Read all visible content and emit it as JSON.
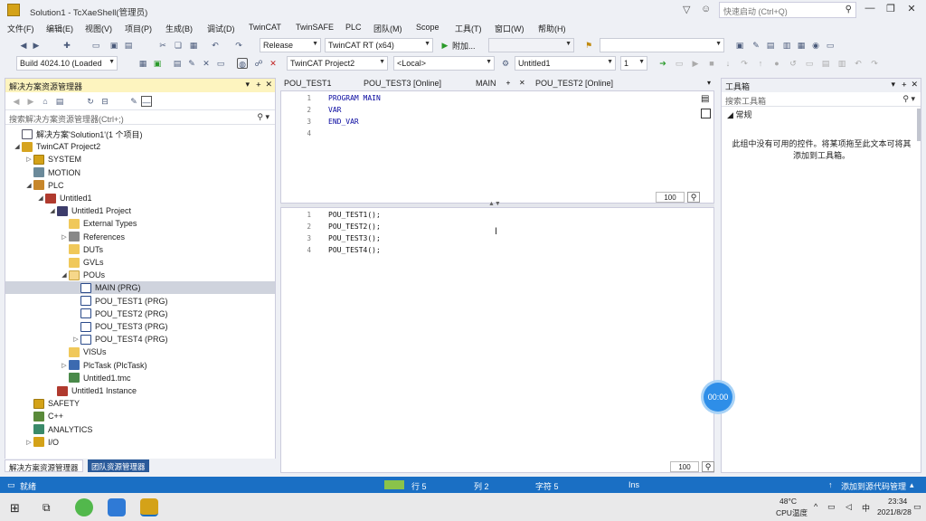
{
  "window": {
    "title": "Solution1 - TcXaeShell(管理员)",
    "quick_launch_placeholder": "快速启动 (Ctrl+Q)"
  },
  "menu": [
    "文件(F)",
    "编辑(E)",
    "视图(V)",
    "项目(P)",
    "生成(B)",
    "调试(D)",
    "TwinCAT",
    "TwinSAFE",
    "PLC",
    "团队(M)",
    "Scope",
    "工具(T)",
    "窗口(W)",
    "帮助(H)"
  ],
  "toolbar1": {
    "config": "Release",
    "platform": "TwinCAT RT (x64)",
    "attach": "附加..."
  },
  "toolbar2": {
    "build": "Build 4024.10 (Loaded",
    "project": "TwinCAT Project2",
    "target": "<Local>",
    "plc": "Untitled1",
    "instance": "1"
  },
  "solution_explorer": {
    "title": "解决方案资源管理器",
    "search_placeholder": "搜索解决方案资源管理器(Ctrl+;)",
    "tree": [
      {
        "label": "解决方案'Solution1'(1 个项目)",
        "level": 0,
        "exp": "",
        "icon": "sol"
      },
      {
        "label": "TwinCAT Project2",
        "level": 0,
        "exp": "◢",
        "icon": "tc"
      },
      {
        "label": "SYSTEM",
        "level": 1,
        "exp": "▷",
        "icon": "sys"
      },
      {
        "label": "MOTION",
        "level": 1,
        "exp": "",
        "icon": "mot"
      },
      {
        "label": "PLC",
        "level": 1,
        "exp": "◢",
        "icon": "plc"
      },
      {
        "label": "Untitled1",
        "level": 2,
        "exp": "◢",
        "icon": "prj2"
      },
      {
        "label": "Untitled1 Project",
        "level": 3,
        "exp": "◢",
        "icon": "proj"
      },
      {
        "label": "External Types",
        "level": 4,
        "exp": "",
        "icon": "fold"
      },
      {
        "label": "References",
        "level": 4,
        "exp": "▷",
        "icon": "ref"
      },
      {
        "label": "DUTs",
        "level": 4,
        "exp": "",
        "icon": "fold"
      },
      {
        "label": "GVLs",
        "level": 4,
        "exp": "",
        "icon": "fold"
      },
      {
        "label": "POUs",
        "level": 4,
        "exp": "◢",
        "icon": "foldo"
      },
      {
        "label": "MAIN (PRG)",
        "level": 5,
        "exp": "",
        "icon": "pou",
        "selected": true
      },
      {
        "label": "POU_TEST1 (PRG)",
        "level": 5,
        "exp": "",
        "icon": "pou"
      },
      {
        "label": "POU_TEST2 (PRG)",
        "level": 5,
        "exp": "",
        "icon": "pou"
      },
      {
        "label": "POU_TEST3 (PRG)",
        "level": 5,
        "exp": "",
        "icon": "pou"
      },
      {
        "label": "POU_TEST4 (PRG)",
        "level": 5,
        "exp": "▷",
        "icon": "pou"
      },
      {
        "label": "VISUs",
        "level": 4,
        "exp": "",
        "icon": "fold"
      },
      {
        "label": "PlcTask (PlcTask)",
        "level": 4,
        "exp": "▷",
        "icon": "task"
      },
      {
        "label": "Untitled1.tmc",
        "level": 4,
        "exp": "",
        "icon": "tmc"
      },
      {
        "label": "Untitled1 Instance",
        "level": 3,
        "exp": "",
        "icon": "inst"
      },
      {
        "label": "SAFETY",
        "level": 1,
        "exp": "",
        "icon": "sys"
      },
      {
        "label": "C++",
        "level": 1,
        "exp": "",
        "icon": "cpp"
      },
      {
        "label": "ANALYTICS",
        "level": 1,
        "exp": "",
        "icon": "ana"
      },
      {
        "label": "I/O",
        "level": 1,
        "exp": "▷",
        "icon": "io"
      }
    ],
    "bottom_tabs": [
      "解决方案资源管理器",
      "团队资源管理器"
    ]
  },
  "doc_tabs": [
    {
      "label": "POU_TEST1",
      "state": "inact"
    },
    {
      "label": "POU_TEST3 [Online]",
      "state": "inact"
    },
    {
      "label": "MAIN",
      "state": "active"
    },
    {
      "label": "POU_TEST2 [Online]",
      "state": "inact"
    }
  ],
  "editor": {
    "decl": [
      "PROGRAM MAIN",
      "VAR",
      "END_VAR",
      ""
    ],
    "body": [
      "POU_TEST1();",
      "POU_TEST2();",
      "POU_TEST3();",
      "POU_TEST4();"
    ],
    "zoom": "100"
  },
  "toolbox": {
    "title": "工具箱",
    "search_placeholder": "搜索工具箱",
    "section": "常规",
    "empty_text": "此组中没有可用的控件。将某项拖至此文本可将其添加到工具箱。"
  },
  "status": {
    "ready": "就绪",
    "line": "行 5",
    "col": "列 2",
    "char": "字符 5",
    "ins": "Ins",
    "source_control": "添加到源代码管理"
  },
  "timer": "00:00",
  "taskbar": {
    "temp": "48°C",
    "temp_label": "CPU温度",
    "ime": "中",
    "time": "23:34",
    "date": "2021/8/28"
  },
  "colors": {
    "accent": "#1a6fc4",
    "panel_header": "#fdf4bf",
    "keyword": "#0a0aa0"
  }
}
